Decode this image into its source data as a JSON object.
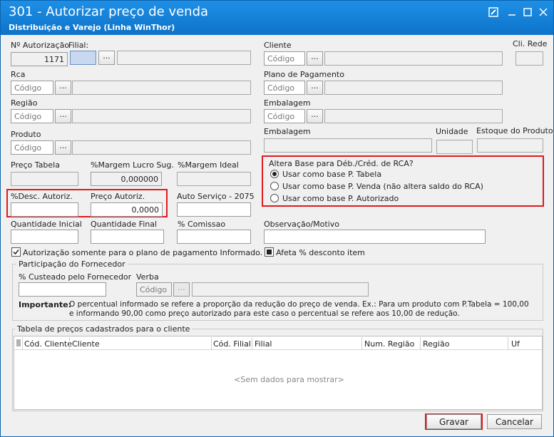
{
  "window": {
    "title": "301 - Autorizar preço de venda",
    "subtitle": "Distribuição e Varejo (Linha WinThor)"
  },
  "fields": {
    "autorizacao_label": "Nº Autorização",
    "autorizacao_value": "1171",
    "filial_label": "Filial:",
    "cliente_label": "Cliente",
    "cliente_placeholder": "Código",
    "cli_rede_label": "Cli. Rede",
    "rca_label": "Rca",
    "rca_placeholder": "Código",
    "plano_label": "Plano de Pagamento",
    "plano_placeholder": "Código",
    "regiao_label": "Região",
    "regiao_placeholder": "Código",
    "embalagem1_label": "Embalagem",
    "embalagem1_placeholder": "Código",
    "produto_label": "Produto",
    "produto_placeholder": "Código",
    "embalagem2_label": "Embalagem",
    "unidade_label": "Unidade",
    "estoque_label": "Estoque do Produto",
    "preco_tabela_label": "Preço Tabela",
    "margem_sug_label": "%Margem Lucro Sug.",
    "margem_sug_value": "0,000000",
    "margem_ideal_label": "%Margem Ideal",
    "desc_autoriz_label": "%Desc. Autoriz.",
    "preco_autoriz_label": "Preço Autoriz.",
    "preco_autoriz_value": "0,0000",
    "auto_servico_label": "Auto Serviço - 2075",
    "qtd_inicial_label": "Quantidade Inicial",
    "qtd_final_label": "Quantidade Final",
    "comissao_label": "% Comissao",
    "observacao_label": "Observação/Motivo",
    "dots": "..."
  },
  "altera_base": {
    "title": "Altera Base para Déb./Créd. de RCA?",
    "options": [
      {
        "label": "Usar como base P. Tabela",
        "selected": true
      },
      {
        "label": "Usar como base P. Venda (não altera saldo do RCA)",
        "selected": false
      },
      {
        "label": "Usar como base P. Autorizado",
        "selected": false
      }
    ]
  },
  "checks": {
    "somente_plano": {
      "label": "Autorização somente para o plano de pagamento Informado.",
      "checked": true
    },
    "afeta_desconto": {
      "label": "Afeta % desconto item",
      "checked": false
    }
  },
  "fornecedor": {
    "title": "Participação do Fornecedor",
    "custeado_label": "% Custeado pelo Fornecedor",
    "verba_label": "Verba",
    "verba_placeholder": "Código",
    "importante_label": "Importante:",
    "importante_line1": "O percentual informado se refere a proporção da redução do preço de venda. Ex.: Para um produto com P.Tabela = 100,00",
    "importante_line2": "e informando 90,00 como preço autorizado para este caso o percentual se refere aos 10,00 de redução."
  },
  "tabela": {
    "title": "Tabela de preços cadastrados para o cliente",
    "columns": [
      "Cód. Cliente",
      "Cliente",
      "Cód. Filial",
      "Filial",
      "Num. Região",
      "Região",
      "Uf"
    ],
    "empty_text": "<Sem dados para mostrar>"
  },
  "actions": {
    "gravar": "Gravar",
    "cancelar": "Cancelar"
  },
  "colors": {
    "title_bar": "#0d73c9",
    "highlight": "#e0191f"
  }
}
